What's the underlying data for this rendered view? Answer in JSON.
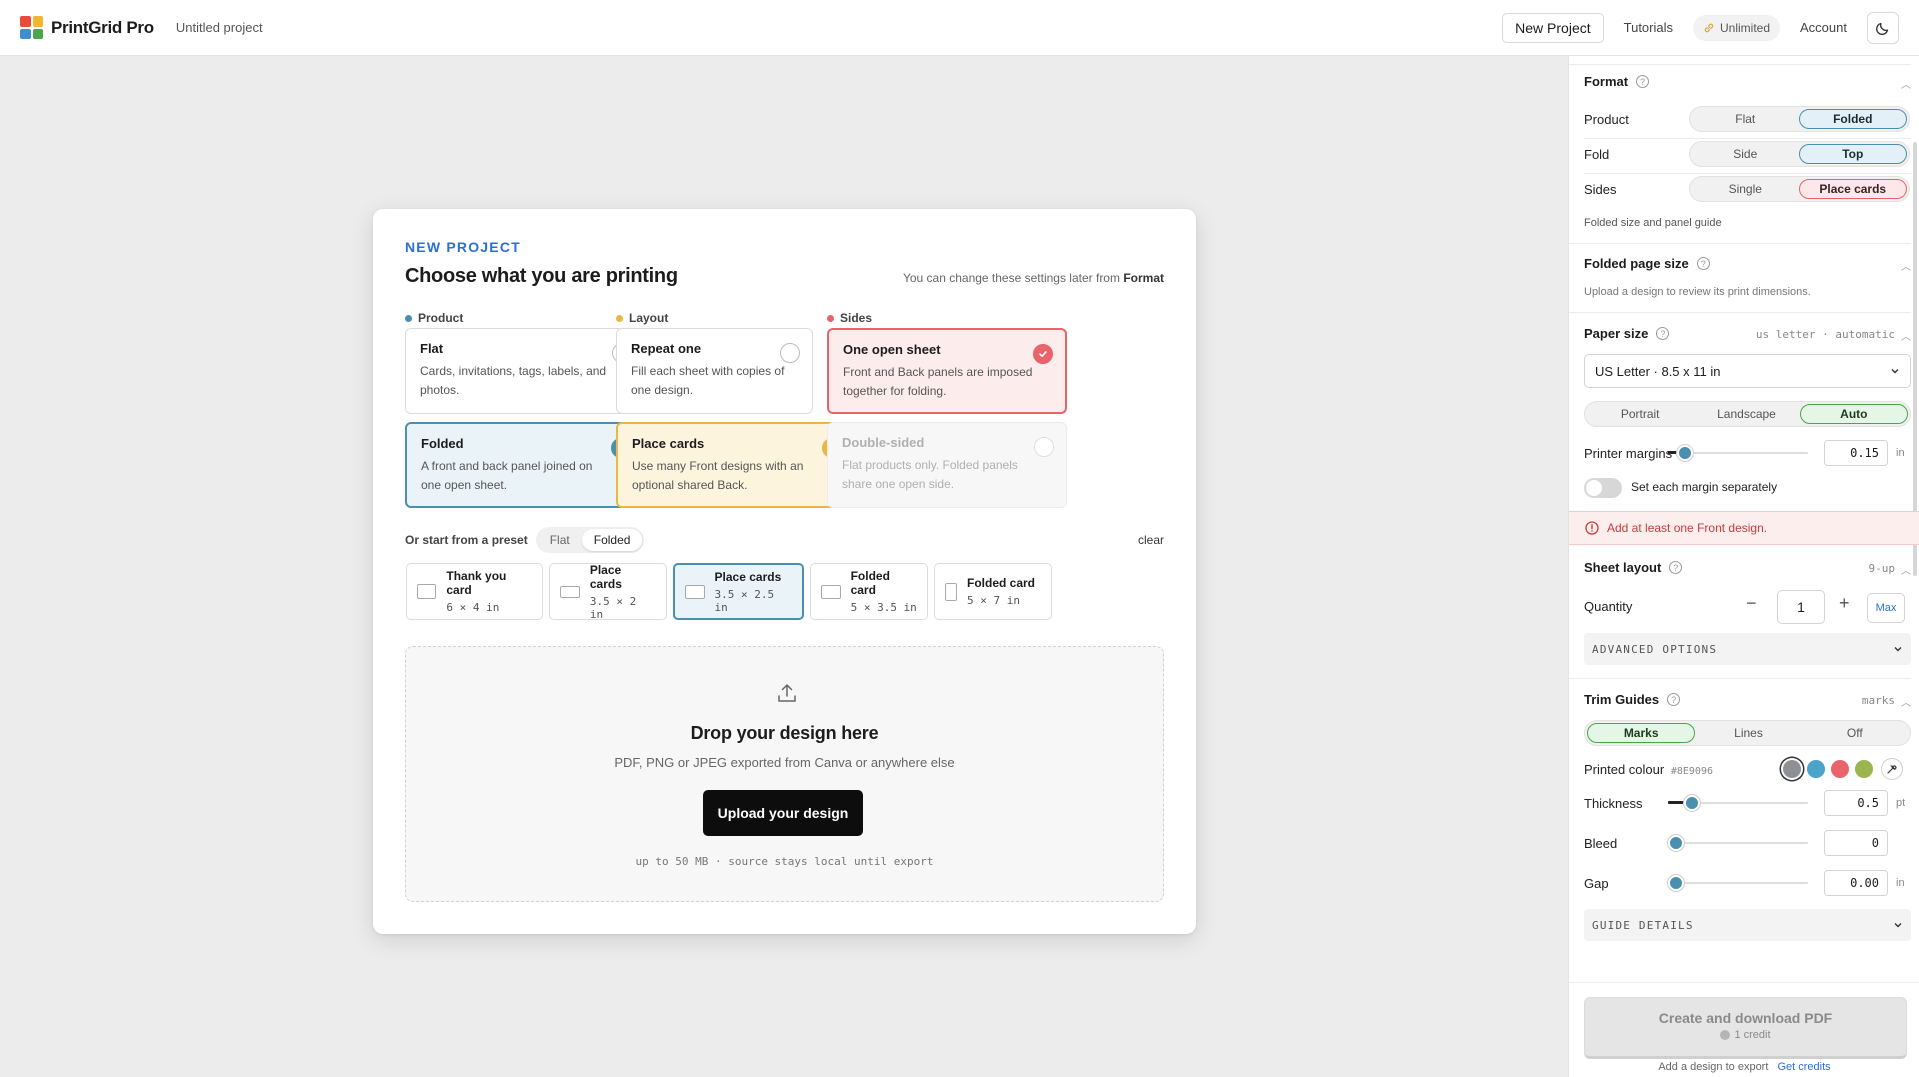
{
  "header": {
    "brand": "PrintGrid Pro",
    "project_name": "Untitled project",
    "new_project_label": "New Project",
    "tutorials_label": "Tutorials",
    "unlimited_label": "Unlimited",
    "account_label": "Account",
    "logo_colors": [
      "#e84b3c",
      "#f2b632",
      "#3d8fcf",
      "#4aa64a"
    ]
  },
  "modal": {
    "eyebrow": "NEW PROJECT",
    "title": "Choose what you are printing",
    "hint_prefix": "You can change these settings later from",
    "hint_link": "Format",
    "columns": [
      {
        "label": "Product",
        "color": "#4a8fb0"
      },
      {
        "label": "Layout",
        "color": "#e9b742"
      },
      {
        "label": "Sides",
        "color": "#e8646a"
      }
    ],
    "options": {
      "flat": {
        "title": "Flat",
        "desc": "Cards, invitations, tags, labels, and photos."
      },
      "folded": {
        "title": "Folded",
        "desc": "A front and back panel joined on one open sheet."
      },
      "repeat_one": {
        "title": "Repeat one",
        "desc": "Fill each sheet with copies of one design."
      },
      "place_cards": {
        "title": "Place cards",
        "desc": "Use many Front designs with an optional shared Back."
      },
      "one_open_sheet": {
        "title": "One open sheet",
        "desc": "Front and Back panels are imposed together for folding."
      },
      "double_sided": {
        "title": "Double-sided",
        "desc": "Flat products only. Folded panels share one open side."
      }
    },
    "preset_label": "Or start from a preset",
    "preset_filter": [
      "Flat",
      "Folded"
    ],
    "preset_filter_selected": "Folded",
    "clear_label": "clear",
    "presets": [
      {
        "name": "Thank you card",
        "size": "6 × 4 in"
      },
      {
        "name": "Place cards",
        "size": "3.5 × 2 in"
      },
      {
        "name": "Place cards",
        "size": "3.5 × 2.5 in"
      },
      {
        "name": "Folded card",
        "size": "5 × 3.5 in"
      },
      {
        "name": "Folded card",
        "size": "5 × 7 in"
      }
    ],
    "selected_preset_index": 2,
    "drop": {
      "title": "Drop your design here",
      "subtitle": "PDF, PNG or JPEG exported from Canva or anywhere else",
      "button": "Upload your design",
      "footnote": "up to 50 MB · source stays local until export"
    }
  },
  "sidebar": {
    "format": {
      "title": "Format",
      "product_label": "Product",
      "product_options": [
        "Flat",
        "Folded"
      ],
      "product_selected": "Folded",
      "fold_label": "Fold",
      "fold_options": [
        "Side",
        "Top"
      ],
      "fold_selected": "Top",
      "sides_label": "Sides",
      "sides_options": [
        "Single",
        "Place cards"
      ],
      "sides_selected": "Place cards",
      "note": "Folded size and panel guide"
    },
    "folded_page_size": {
      "title": "Folded page size",
      "note": "Upload a design to review its print dimensions."
    },
    "paper_size": {
      "title": "Paper size",
      "meta": "us letter · automatic",
      "select_value": "US Letter · 8.5 x 11 in",
      "orientation_options": [
        "Portrait",
        "Landscape",
        "Auto"
      ],
      "orientation_selected": "Auto",
      "margins_label": "Printer margins",
      "margins_value": "0.15",
      "margins_unit": "in",
      "separate_margins_label": "Set each margin separately",
      "separate_margins_on": false
    },
    "alert": "Add at least one Front design.",
    "sheet_layout": {
      "title": "Sheet layout",
      "meta": "9-up",
      "quantity_label": "Quantity",
      "quantity_value": "1",
      "max_label": "Max",
      "advanced_label": "ADVANCED OPTIONS"
    },
    "trim_guides": {
      "title": "Trim Guides",
      "meta": "marks",
      "mode_options": [
        "Marks",
        "Lines",
        "Off"
      ],
      "mode_selected": "Marks",
      "colour_label": "Printed colour",
      "colour_hex": "#8E9096",
      "swatches": [
        "#8e9096",
        "#4aa3c9",
        "#e8646a",
        "#9ab54e"
      ],
      "thickness_label": "Thickness",
      "thickness_value": "0.5",
      "thickness_unit": "pt",
      "bleed_label": "Bleed",
      "bleed_value": "0",
      "gap_label": "Gap",
      "gap_value": "0.00",
      "gap_unit": "in",
      "details_label": "GUIDE DETAILS"
    },
    "export": {
      "button": "Create and download PDF",
      "credit": "1 credit",
      "note": "Add a design to export",
      "get_credits": "Get credits"
    }
  }
}
